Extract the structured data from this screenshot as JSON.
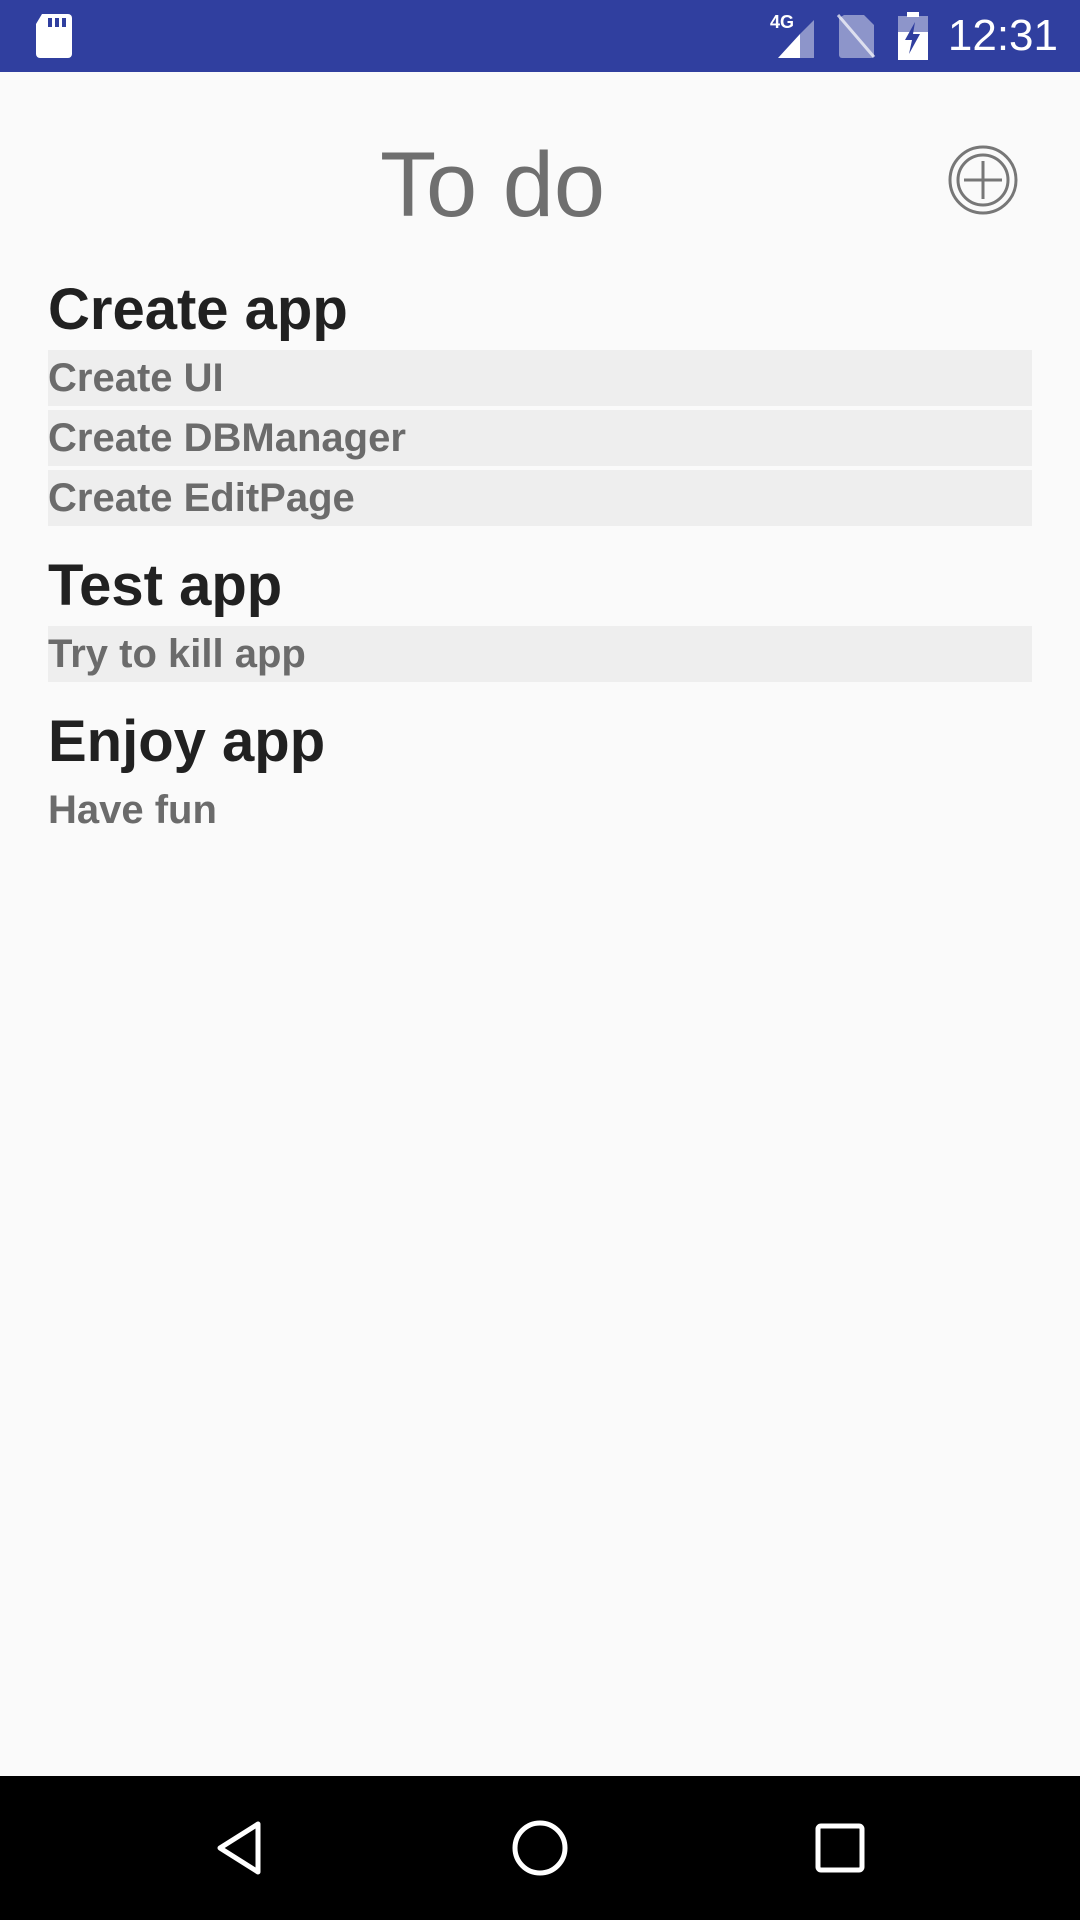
{
  "status_bar": {
    "time": "12:31",
    "network": "4G",
    "icons": [
      "sd-card-icon",
      "signal-icon",
      "no-sim-icon",
      "battery-charging-icon"
    ]
  },
  "header": {
    "title": "To do",
    "add_icon": "add-circle-icon"
  },
  "groups": [
    {
      "title": "Create app",
      "items": [
        "Create UI",
        "Create DBManager",
        "Create EditPage"
      ]
    },
    {
      "title": "Test app",
      "items": [
        "Try to kill app"
      ]
    },
    {
      "title": "Enjoy app",
      "items": [
        "Have fun"
      ]
    }
  ],
  "nav_bar": {
    "icons": [
      "back-icon",
      "home-icon",
      "recents-icon"
    ]
  },
  "colors": {
    "status_bar": "#303f9f",
    "background": "#fafafa",
    "item_background": "#eeeeee",
    "group_title": "#212121",
    "item_text": "#6b6b6b"
  }
}
